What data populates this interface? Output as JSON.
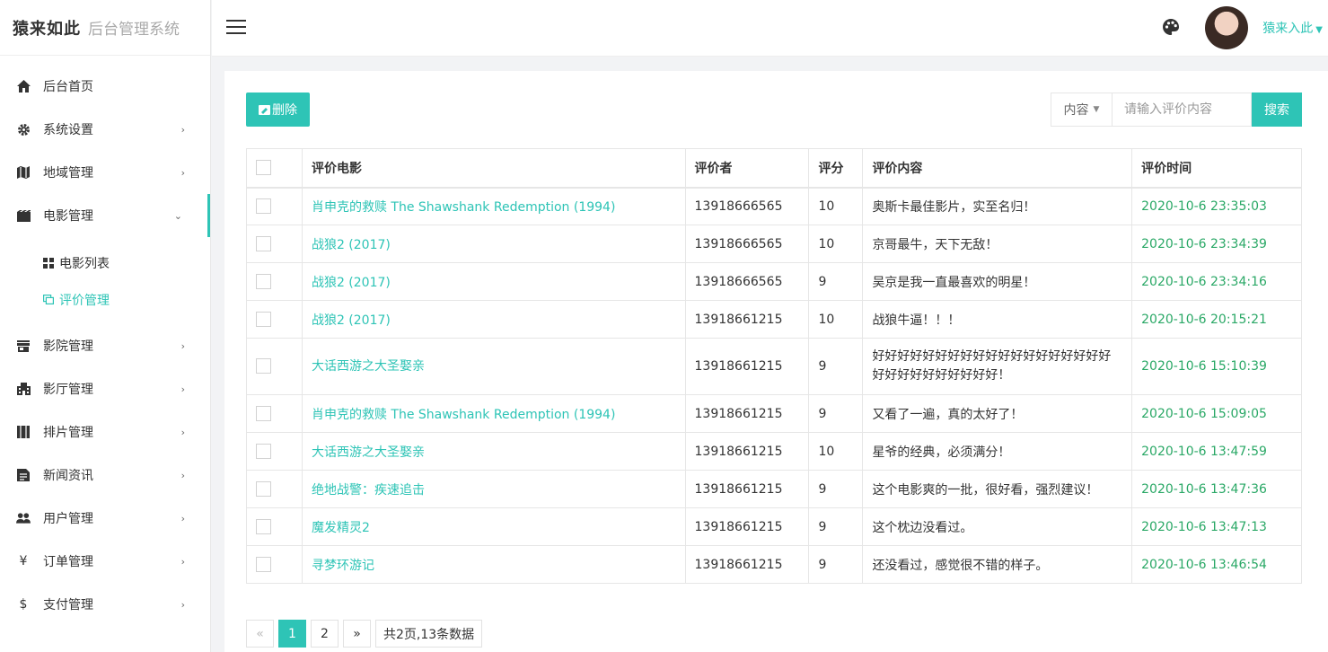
{
  "brand": {
    "logo": "猿来如此",
    "system": "后台管理系统"
  },
  "sidebar": {
    "items": [
      {
        "label": "后台首页",
        "icon": "home-icon"
      },
      {
        "label": "系统设置",
        "icon": "gear-icon"
      },
      {
        "label": "地域管理",
        "icon": "map-icon"
      },
      {
        "label": "电影管理",
        "icon": "film-icon"
      },
      {
        "label": "影院管理",
        "icon": "store-icon"
      },
      {
        "label": "影厅管理",
        "icon": "building-icon"
      },
      {
        "label": "排片管理",
        "icon": "schedule-icon"
      },
      {
        "label": "新闻资讯",
        "icon": "news-icon"
      },
      {
        "label": "用户管理",
        "icon": "users-icon"
      },
      {
        "label": "订单管理",
        "icon": "yen-icon"
      },
      {
        "label": "支付管理",
        "icon": "dollar-icon"
      }
    ],
    "submenu": [
      {
        "label": "电影列表",
        "icon": "grid-icon"
      },
      {
        "label": "评价管理",
        "icon": "comment-icon"
      }
    ]
  },
  "header": {
    "username": "猿来入此"
  },
  "toolbar": {
    "delete_label": "删除",
    "search_type": "内容",
    "search_placeholder": "请输入评价内容",
    "search_label": "搜索"
  },
  "table": {
    "headers": [
      "评价电影",
      "评价者",
      "评分",
      "评价内容",
      "评价时间"
    ],
    "rows": [
      {
        "movie": "肖申克的救赎 The Shawshank Redemption (1994)",
        "user": "13918666565",
        "score": "10",
        "content": "奥斯卡最佳影片，实至名归！",
        "time": "2020-10-6 23:35:03"
      },
      {
        "movie": "战狼2 (2017)",
        "user": "13918666565",
        "score": "10",
        "content": "京哥最牛，天下无敌！",
        "time": "2020-10-6 23:34:39"
      },
      {
        "movie": "战狼2 (2017)",
        "user": "13918666565",
        "score": "9",
        "content": "吴京是我一直最喜欢的明星！",
        "time": "2020-10-6 23:34:16"
      },
      {
        "movie": "战狼2 (2017)",
        "user": "13918661215",
        "score": "10",
        "content": "战狼牛逼！！！",
        "time": "2020-10-6 20:15:21"
      },
      {
        "movie": "大话西游之大圣娶亲",
        "user": "13918661215",
        "score": "9",
        "content": "好好好好好好好好好好好好好好好好好好好好好好好好好好好好好！",
        "time": "2020-10-6 15:10:39"
      },
      {
        "movie": "肖申克的救赎 The Shawshank Redemption (1994)",
        "user": "13918661215",
        "score": "9",
        "content": "又看了一遍，真的太好了！",
        "time": "2020-10-6 15:09:05"
      },
      {
        "movie": "大话西游之大圣娶亲",
        "user": "13918661215",
        "score": "10",
        "content": "星爷的经典，必须满分！",
        "time": "2020-10-6 13:47:59"
      },
      {
        "movie": "绝地战警：疾速追击",
        "user": "13918661215",
        "score": "9",
        "content": "这个电影爽的一批，很好看，强烈建议！",
        "time": "2020-10-6 13:47:36"
      },
      {
        "movie": "魔发精灵2",
        "user": "13918661215",
        "score": "9",
        "content": "这个枕边没看过。",
        "time": "2020-10-6 13:47:13"
      },
      {
        "movie": "寻梦环游记",
        "user": "13918661215",
        "score": "9",
        "content": "还没看过，感觉很不错的样子。",
        "time": "2020-10-6 13:46:54"
      }
    ]
  },
  "pagination": {
    "prev": "«",
    "pages": [
      "1",
      "2"
    ],
    "next": "»",
    "info": "共2页,13条数据"
  },
  "colors": {
    "accent": "#2ec4b6",
    "time": "#2aa866"
  }
}
